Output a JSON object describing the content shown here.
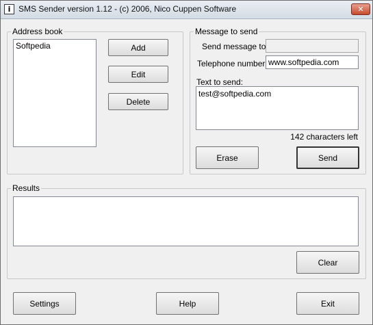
{
  "window": {
    "title": "SMS Sender version 1.12  -  (c) 2006, Nico Cuppen Software",
    "close_glyph": "✕",
    "icon_name": "app-phone-icon"
  },
  "address_book": {
    "legend": "Address book",
    "items": [
      "Softpedia"
    ],
    "add_label": "Add",
    "edit_label": "Edit",
    "delete_label": "Delete"
  },
  "message": {
    "legend": "Message to send",
    "send_to_label": "Send message to:",
    "send_to_value": "",
    "phone_label": "Telephone number:",
    "phone_value": "www.softpedia.com",
    "text_label": "Text to send:",
    "text_value": "test@softpedia.com",
    "chars_left": "142 characters left",
    "erase_label": "Erase",
    "send_label": "Send"
  },
  "results": {
    "legend": "Results",
    "clear_label": "Clear"
  },
  "footer": {
    "settings_label": "Settings",
    "help_label": "Help",
    "exit_label": "Exit"
  }
}
